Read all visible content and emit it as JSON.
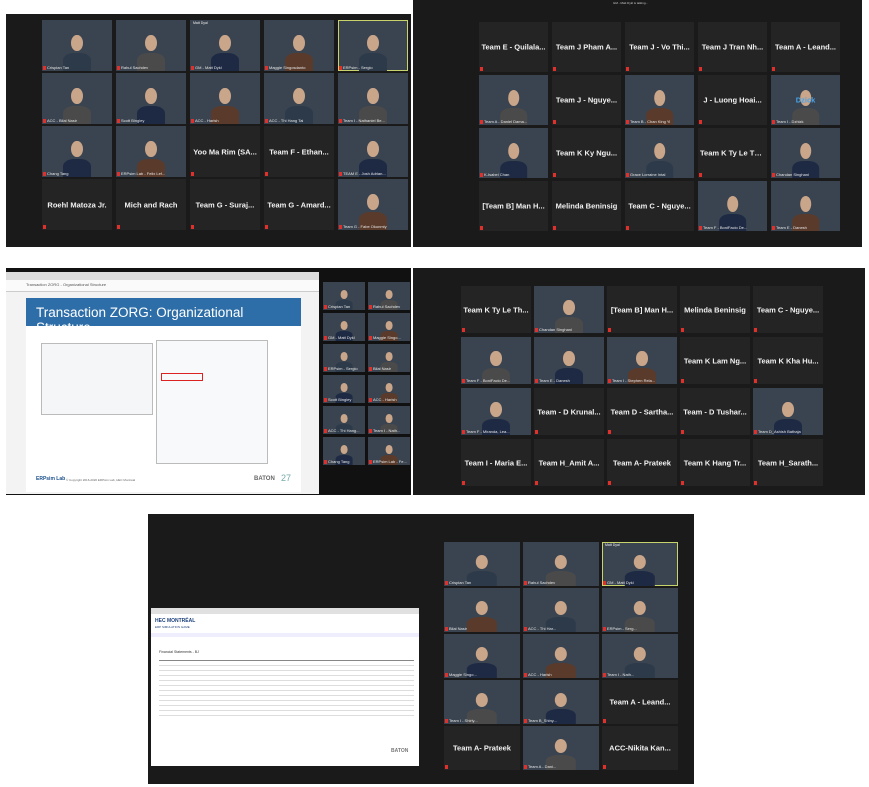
{
  "panel1_left": {
    "tiles": [
      {
        "label": "Crispian Tan",
        "video": true
      },
      {
        "label": "Rahul Sachdev",
        "video": true
      },
      {
        "label": "GM - Matt Dykl",
        "video": true,
        "top": "Matt Dyal"
      },
      {
        "label": "Maggie Singosdanto",
        "video": true
      },
      {
        "label": "ERPsim - Sergio",
        "video": true,
        "active": true
      },
      {
        "label": "ACC - Bilal Nasir",
        "video": true
      },
      {
        "label": "Scott Bingley",
        "video": true
      },
      {
        "label": "ACC - Harish",
        "video": true
      },
      {
        "label": "ACC - Thi Hang Tai",
        "video": true
      },
      {
        "label": "Team I - Nathaniel Be...",
        "video": true
      },
      {
        "label": "Chang Tang",
        "video": true
      },
      {
        "label": "ERPsim Lab - Felix Lef...",
        "video": true
      },
      {
        "name": "Yoo Ma Rim (SA..."
      },
      {
        "name": "Team F - Ethan..."
      },
      {
        "label": "TEAM E - Josh Adrian...",
        "video": true
      },
      {
        "name": "Roehl Matoza Jr."
      },
      {
        "name": "Mich and Rach"
      },
      {
        "name": "Team G - Suraj..."
      },
      {
        "name": "Team G - Amard..."
      },
      {
        "label": "Team G - Fabe Okunmiy",
        "video": true
      }
    ]
  },
  "panel1_right": {
    "header": "GM - Matt Dykl is talking...",
    "tiles": [
      {
        "name": "Team E - Quilala..."
      },
      {
        "name": "Team J Pham A..."
      },
      {
        "name": "Team J - Vo Thi..."
      },
      {
        "name": "Team J Tran Nh..."
      },
      {
        "name": "Team A - Leand..."
      },
      {
        "label": "Team A - Daniel Dama...",
        "video": true
      },
      {
        "name": "Team J - Nguye..."
      },
      {
        "label": "Team B - Chan King Yi",
        "video": true
      },
      {
        "name": "J - Luong Hoai..."
      },
      {
        "label": "Team I - Dzhizk",
        "video": true,
        "text": "Dzick"
      },
      {
        "label": "K-Isabel Chan",
        "video": true
      },
      {
        "name": "Team K Ky Ngu..."
      },
      {
        "label": "Grace Lorraine Intal",
        "video": true
      },
      {
        "name": "Team K Ty Le Th..."
      },
      {
        "label": "Chandan Singhani",
        "video": true
      },
      {
        "name": "[Team B] Man H..."
      },
      {
        "name": "Melinda Beninsig"
      },
      {
        "name": "Team C - Nguye..."
      },
      {
        "label": "Team F - BoniFacio De...",
        "video": true
      },
      {
        "label": "Team E - Danesh",
        "video": true
      }
    ]
  },
  "panel2_left": {
    "browser_url": "Transaction ZORG - Organizational Structure",
    "slide_title": "Transaction ZORG: Organizational Structure",
    "footer_logo": "ERPsim Lab",
    "footer_copyright": "© Copyright 2016-2020 ERPsim Lab, HEC Montréal",
    "page_number": "27",
    "brand": "BATON",
    "side_tiles": [
      {
        "label": "Crispian Tan"
      },
      {
        "label": "Rahul Sachdev"
      },
      {
        "label": "GM - Matt Dykl"
      },
      {
        "label": "Maggie Singo..."
      },
      {
        "label": "ERPsim - Sergio"
      },
      {
        "label": "Bilal Nasir"
      },
      {
        "label": "Scott Bingley"
      },
      {
        "label": "ACC - Harish"
      },
      {
        "label": "ACC - Thi Hang..."
      },
      {
        "label": "Team I - Nath..."
      },
      {
        "label": "Chang Tang"
      },
      {
        "label": "ERPsim Lab - Fe..."
      }
    ]
  },
  "panel2_right": {
    "tiles": [
      {
        "name": "Team K Ty Le Th..."
      },
      {
        "label": "Chandan Singhani",
        "video": true
      },
      {
        "name": "[Team B] Man H..."
      },
      {
        "name": "Melinda Beninsig"
      },
      {
        "name": "Team C - Nguye..."
      },
      {
        "label": "Team F - BoniFacio De...",
        "video": true
      },
      {
        "label": "Team E - Danesh",
        "video": true
      },
      {
        "label": "Team I - Stephen Rela...",
        "video": true
      },
      {
        "name": "Team K Lam Ng..."
      },
      {
        "name": "Team K Kha Hu..."
      },
      {
        "label": "Team F - Miranda, Lea...",
        "video": true
      },
      {
        "name": "Team - D Krunal..."
      },
      {
        "name": "Team D - Sartha..."
      },
      {
        "name": "Team - D Tushar..."
      },
      {
        "label": "Team D_Ashish Bathaja",
        "video": true
      },
      {
        "name": "Team I - Maria E..."
      },
      {
        "name": "Team H_Amit A..."
      },
      {
        "name": "Team A- Prateek"
      },
      {
        "name": "Team K Hang Tr..."
      },
      {
        "name": "Team H_Sarath..."
      }
    ]
  },
  "panel3_left": {
    "logo": "HEC MONTRÉAL",
    "subtitle": "ERP SIMULATION GAME",
    "section": "Financial Statements - BJ",
    "brand": "BATON"
  },
  "panel3_right": {
    "tiles": [
      {
        "label": "Crispian Tan",
        "video": true
      },
      {
        "label": "Rahul Sachdev",
        "video": true
      },
      {
        "label": "GM - Matt Dykl",
        "video": true,
        "active": true,
        "top": "Matt Dyal"
      },
      {
        "label": "Bilal Nasir",
        "video": true
      },
      {
        "label": "ACC - Thi Har...",
        "video": true
      },
      {
        "label": "ERPsim - Serg...",
        "video": true
      },
      {
        "label": "Maggie Singo...",
        "video": true
      },
      {
        "label": "ACC - Harish",
        "video": true
      },
      {
        "label": "Team I - Nath...",
        "video": true
      },
      {
        "label": "Team I - Shirly...",
        "video": true
      },
      {
        "label": "Team B_Shiny...",
        "video": true
      },
      {
        "name": "Team A - Leand..."
      },
      {
        "name": "Team A- Prateek"
      },
      {
        "label": "Team A - Dani...",
        "video": true
      },
      {
        "name": "ACC-Nikita Kan..."
      }
    ]
  }
}
